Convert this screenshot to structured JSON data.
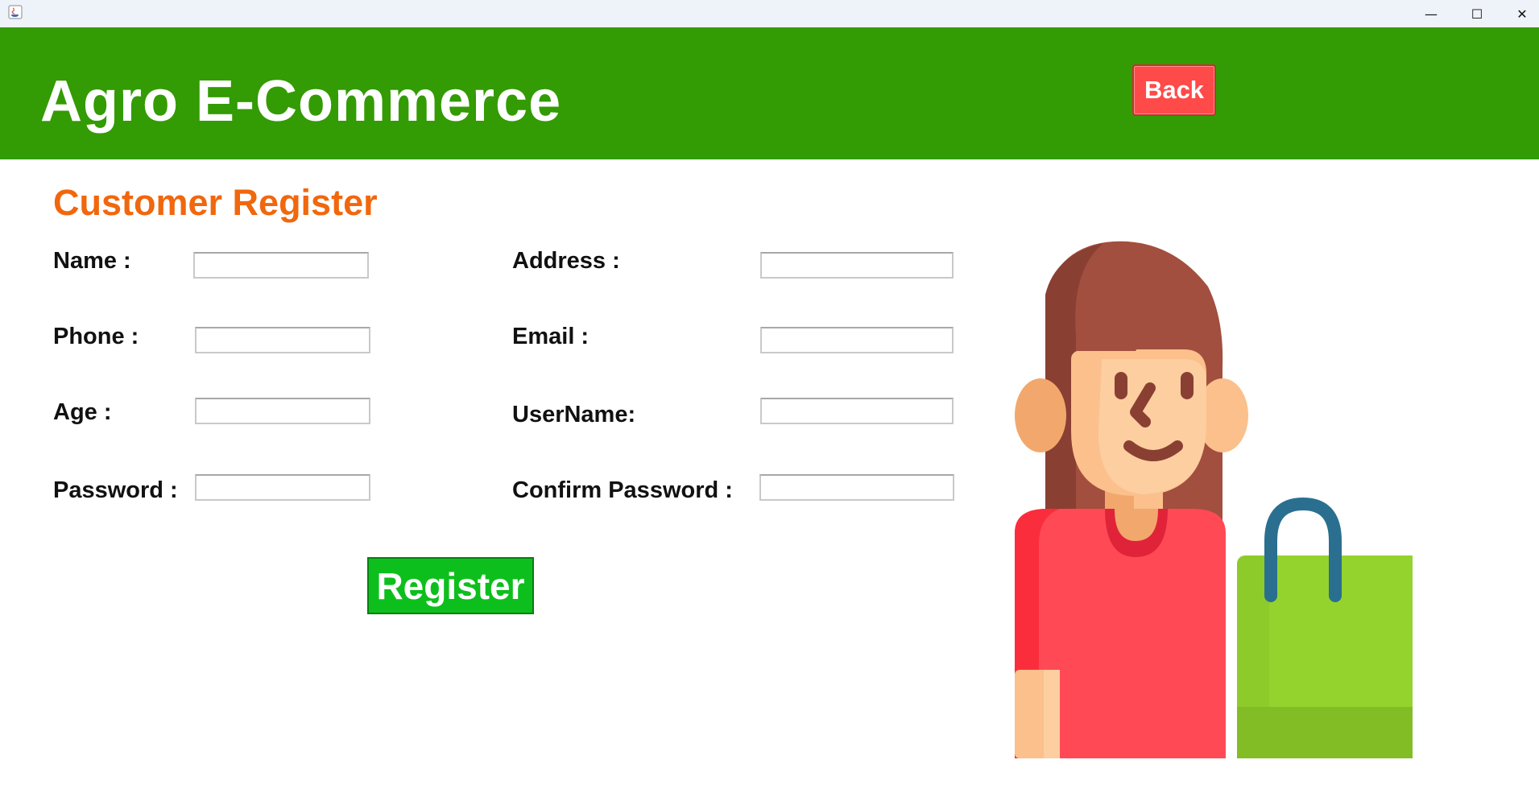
{
  "window": {
    "minimize": "—",
    "maximize": "☐",
    "close": "✕"
  },
  "header": {
    "title": "Agro E-Commerce",
    "back_label": "Back"
  },
  "form": {
    "title": "Customer Register",
    "fields": {
      "name": {
        "label": "Name :",
        "value": ""
      },
      "phone": {
        "label": "Phone :",
        "value": ""
      },
      "age": {
        "label": "Age :",
        "value": ""
      },
      "password": {
        "label": "Password :",
        "value": ""
      },
      "address": {
        "label": "Address :",
        "value": ""
      },
      "email": {
        "label": "Email :",
        "value": ""
      },
      "username": {
        "label": "UserName:",
        "value": ""
      },
      "confirm_password": {
        "label": "Confirm Password :",
        "value": ""
      }
    },
    "register_label": "Register"
  },
  "illustration": {
    "icon": "shopper-woman-with-bag-icon",
    "colors": {
      "hair": "#a24f3f",
      "skin": "#fbc08c",
      "shirt": "#ff4a55",
      "bag": "#8dcb2b",
      "bag_handle": "#2a6f8f"
    }
  },
  "colors": {
    "header_green": "#339b03",
    "title_orange": "#f1670d",
    "back_red": "#ff4a4a",
    "register_green": "#0dbf1c"
  }
}
